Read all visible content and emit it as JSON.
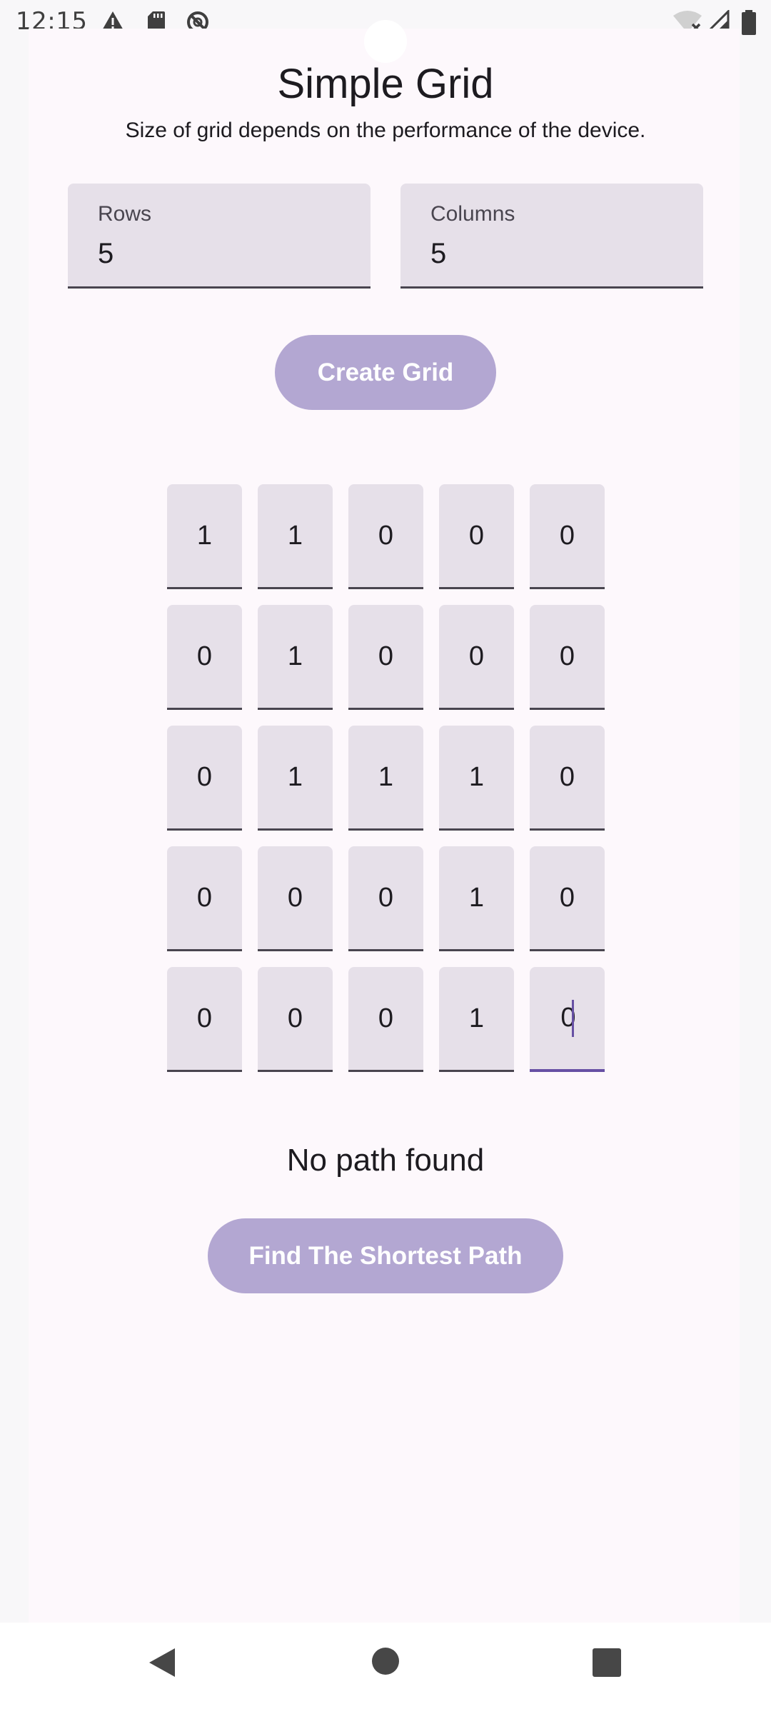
{
  "status_bar": {
    "time": "12:15",
    "left_icons": [
      "alert-triangle-icon",
      "sd-card-icon",
      "no-signal-circle-icon"
    ],
    "right_icons": [
      "wifi-off-icon",
      "cell-signal-icon",
      "battery-icon"
    ]
  },
  "header": {
    "title": "Simple Grid",
    "subtitle": "Size of grid depends on the performance of the device."
  },
  "inputs": {
    "rows": {
      "label": "Rows",
      "value": "5"
    },
    "columns": {
      "label": "Columns",
      "value": "5"
    }
  },
  "buttons": {
    "create_grid": "Create Grid",
    "find_path": "Find The Shortest Path"
  },
  "grid": {
    "rows": [
      [
        "1",
        "1",
        "0",
        "0",
        "0"
      ],
      [
        "0",
        "1",
        "0",
        "0",
        "0"
      ],
      [
        "0",
        "1",
        "1",
        "1",
        "0"
      ],
      [
        "0",
        "0",
        "0",
        "1",
        "0"
      ],
      [
        "0",
        "0",
        "0",
        "1",
        "0"
      ]
    ],
    "focused_cell": {
      "row": 4,
      "col": 4
    }
  },
  "result": {
    "text": "No path found"
  },
  "nav_bar": {
    "buttons": [
      "back-icon",
      "home-icon",
      "recents-icon"
    ]
  },
  "colors": {
    "accent": "#6750a4",
    "button_disabled": "#b3a7d2",
    "field_bg": "#e6e0e9",
    "surface": "#fdf8fc"
  }
}
